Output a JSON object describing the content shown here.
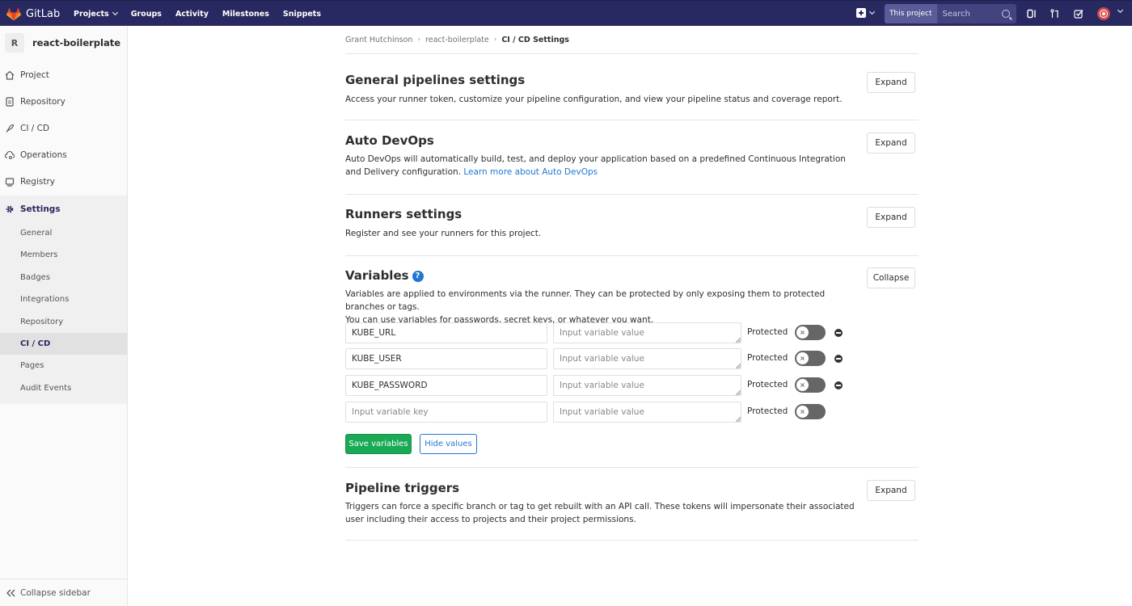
{
  "navbar": {
    "brand": "GitLab",
    "links": [
      "Projects",
      "Groups",
      "Activity",
      "Milestones",
      "Snippets"
    ],
    "search_scope": "This project",
    "search_placeholder": "Search"
  },
  "sidebar": {
    "project_initial": "R",
    "project_name": "react-boilerplate",
    "items": [
      "Project",
      "Repository",
      "CI / CD",
      "Operations",
      "Registry",
      "Settings"
    ],
    "settings_sub": [
      "General",
      "Members",
      "Badges",
      "Integrations",
      "Repository",
      "CI / CD",
      "Pages",
      "Audit Events"
    ],
    "collapse_label": "Collapse sidebar"
  },
  "breadcrumb": {
    "user": "Grant Hutchinson",
    "project": "react-boilerplate",
    "current": "CI / CD Settings"
  },
  "sections": {
    "general": {
      "title": "General pipelines settings",
      "desc": "Access your runner token, customize your pipeline configuration, and view your pipeline status and coverage report.",
      "button": "Expand"
    },
    "autodevops": {
      "title": "Auto DevOps",
      "desc": "Auto DevOps will automatically build, test, and deploy your application based on a predefined Continuous Integration and Delivery configuration.",
      "link": "Learn more about Auto DevOps",
      "button": "Expand"
    },
    "runners": {
      "title": "Runners settings",
      "desc": "Register and see your runners for this project.",
      "button": "Expand"
    },
    "variables": {
      "title": "Variables",
      "desc_line1": "Variables are applied to environments via the runner. They can be protected by only exposing them to protected branches or tags.",
      "desc_line2": "You can use variables for passwords, secret keys, or whatever you want.",
      "button": "Collapse",
      "key_placeholder": "Input variable key",
      "value_placeholder": "Input variable value",
      "protected_label": "Protected",
      "rows": [
        {
          "key": "KUBE_URL",
          "value": "",
          "protected": false
        },
        {
          "key": "KUBE_USER",
          "value": "",
          "protected": false
        },
        {
          "key": "KUBE_PASSWORD",
          "value": "",
          "protected": false
        },
        {
          "key": "",
          "value": "",
          "protected": false
        }
      ],
      "save_label": "Save variables",
      "hide_label": "Hide values"
    },
    "triggers": {
      "title": "Pipeline triggers",
      "desc": "Triggers can force a specific branch or tag to get rebuilt with an API call. These tokens will impersonate their associated user including their access to projects and their project permissions.",
      "button": "Expand"
    }
  },
  "colors": {
    "navbar": "#292961",
    "accent": "#1f78d1",
    "success": "#1aaa55"
  }
}
